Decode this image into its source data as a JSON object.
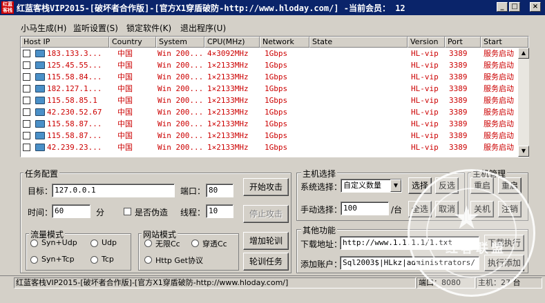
{
  "window": {
    "title": "红蓝客栈VIP2015-[破坏者合作版]-[官方X1穿盾破防-http://www.hloday.com/] -当前会员： 12",
    "logo_text": "红蓝客栈",
    "min": "_",
    "max": "□",
    "close": "×"
  },
  "menu": [
    "小马生成(H)",
    "监听设置(S)",
    "锁定软件(K)",
    "退出程序(U)"
  ],
  "columns": [
    "Host IP",
    "Country",
    "System",
    "CPU(MHz)",
    "Network",
    "State",
    "Version",
    "Port",
    "Start"
  ],
  "rows": [
    {
      "ip": "183.133.3...",
      "country": "中国",
      "system": "Win 200...",
      "cpu": "4×3092MHz",
      "network": "1Gbps",
      "state": "",
      "version": "HL-vip",
      "port": "3389",
      "start": "服务启动"
    },
    {
      "ip": "125.45.55...",
      "country": "中国",
      "system": "Win 200...",
      "cpu": "1×2133MHz",
      "network": "1Gbps",
      "state": "",
      "version": "HL-vip",
      "port": "3389",
      "start": "服务启动"
    },
    {
      "ip": "115.58.84...",
      "country": "中国",
      "system": "Win 200...",
      "cpu": "1×2133MHz",
      "network": "1Gbps",
      "state": "",
      "version": "HL-vip",
      "port": "3389",
      "start": "服务启动"
    },
    {
      "ip": "182.127.1...",
      "country": "中国",
      "system": "Win 200...",
      "cpu": "1×2133MHz",
      "network": "1Gbps",
      "state": "",
      "version": "HL-vip",
      "port": "3389",
      "start": "服务启动"
    },
    {
      "ip": "115.58.85.1",
      "country": "中国",
      "system": "Win 200...",
      "cpu": "1×2133MHz",
      "network": "1Gbps",
      "state": "",
      "version": "HL-vip",
      "port": "3389",
      "start": "服务启动"
    },
    {
      "ip": "42.230.52.67",
      "country": "中国",
      "system": "Win 200...",
      "cpu": "1×2133MHz",
      "network": "1Gbps",
      "state": "",
      "version": "HL-vip",
      "port": "3389",
      "start": "服务启动"
    },
    {
      "ip": "115.58.87...",
      "country": "中国",
      "system": "Win 200...",
      "cpu": "1×2133MHz",
      "network": "1Gbps",
      "state": "",
      "version": "HL-vip",
      "port": "3389",
      "start": "服务启动"
    },
    {
      "ip": "115.58.87...",
      "country": "中国",
      "system": "Win 200...",
      "cpu": "1×2133MHz",
      "network": "1Gbps",
      "state": "",
      "version": "HL-vip",
      "port": "3389",
      "start": "服务启动"
    },
    {
      "ip": "42.239.23...",
      "country": "中国",
      "system": "Win 200...",
      "cpu": "1×2133MHz",
      "network": "1Gbps",
      "state": "",
      "version": "HL-vip",
      "port": "3389",
      "start": "服务启动"
    }
  ],
  "task": {
    "group": "任务配置",
    "target_label": "目标：",
    "target_value": "127.0.0.1",
    "port_label": "端口：",
    "port_value": "80",
    "time_label": "时间：",
    "time_value": "60",
    "time_unit": "分",
    "spoof_label": "是否伪造",
    "threads_label": "线程：",
    "threads_value": "10",
    "start_btn": "开始攻击",
    "stop_btn": "停止攻击"
  },
  "flow": {
    "group": "流量模式",
    "opts": [
      "Syn+Udp",
      "Udp",
      "Syn+Tcp",
      "Tcp"
    ]
  },
  "site": {
    "group": "网站模式",
    "opts": [
      "无限Cc",
      "穿透Cc",
      "Http Get协议"
    ]
  },
  "rotation": {
    "add_btn": "增加轮训",
    "task_btn": "轮训任务"
  },
  "host_select": {
    "group": "主机选择",
    "sys_label": "系统选择：",
    "sys_value": "自定义数量",
    "manual_label": "手动选择：",
    "manual_value": "100",
    "manual_unit": "/台",
    "btn_select": "选择",
    "btn_reselect": "反选",
    "btn_all": "全选",
    "btn_cancel": "取消"
  },
  "host_mgmt": {
    "group": "主机管理",
    "btn_restart1": "重启",
    "btn_restart2": "重启",
    "btn_shutdown": "关机",
    "btn_logoff": "注销"
  },
  "other": {
    "group": "其他功能",
    "download_label": "下载地址：",
    "download_value": "http://www.1.1.1.1/1.txt",
    "download_btn": "下载执行",
    "account_label": "添加账户：",
    "account_value": "Sql2003$|HLkz|administrators/",
    "account_btn": "执行添加"
  },
  "status": {
    "text": "红蓝客栈VIP2015-[破坏者合作版]-[官方X1穿盾破防-http://www.hloday.com/]",
    "port": "端口：8080",
    "hosts": "主机：27 台"
  },
  "watermark": {
    "text": "红客联盟",
    "icon": "star-icon"
  }
}
